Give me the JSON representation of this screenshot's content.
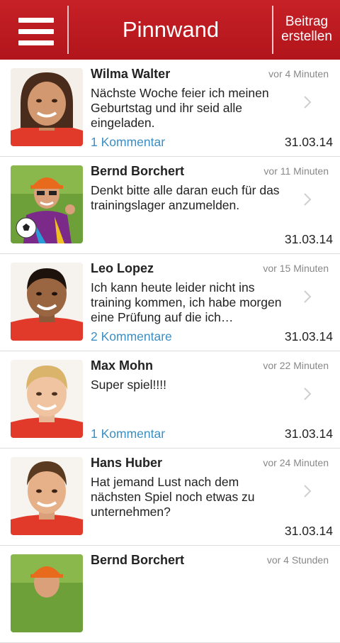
{
  "header": {
    "title": "Pinnwand",
    "create_line1": "Beitrag",
    "create_line2": "erstellen",
    "menu_icon": "hamburger-menu-icon",
    "color": "#c0191f"
  },
  "posts": [
    {
      "name": "Wilma Walter",
      "time": "vor 4 Minuten",
      "text": "Nächste Woche feier ich meinen Geburtstag und ihr seid alle eingeladen.",
      "comments": "1 Kommentar",
      "date": "31.03.14",
      "avatar": "girl-portrait"
    },
    {
      "name": "Bernd Borchert",
      "time": "vor 11 Minuten",
      "text": "Denkt bitte alle daran euch für das trainingslager anzumelden.",
      "comments": "",
      "date": "31.03.14",
      "avatar": "coach-portrait"
    },
    {
      "name": "Leo Lopez",
      "time": "vor 15 Minuten",
      "text": "Ich kann heute leider nicht ins training kommen, ich habe morgen eine Prüfung auf die ich…",
      "comments": "2 Kommentare",
      "date": "31.03.14",
      "avatar": "boy-portrait"
    },
    {
      "name": "Max Mohn",
      "time": "vor 22 Minuten",
      "text": "Super spiel!!!!",
      "comments": "1 Kommentar",
      "date": "31.03.14",
      "avatar": "blond-boy-portrait"
    },
    {
      "name": "Hans Huber",
      "time": "vor 24 Minuten",
      "text": "Hat jemand Lust nach dem nächsten Spiel noch etwas zu unternehmen?",
      "comments": "",
      "date": "31.03.14",
      "avatar": "brown-hair-boy-portrait"
    },
    {
      "name": "Bernd Borchert",
      "time": "vor 4 Stunden",
      "text": "",
      "comments": "",
      "date": "",
      "avatar": "coach-portrait"
    }
  ]
}
